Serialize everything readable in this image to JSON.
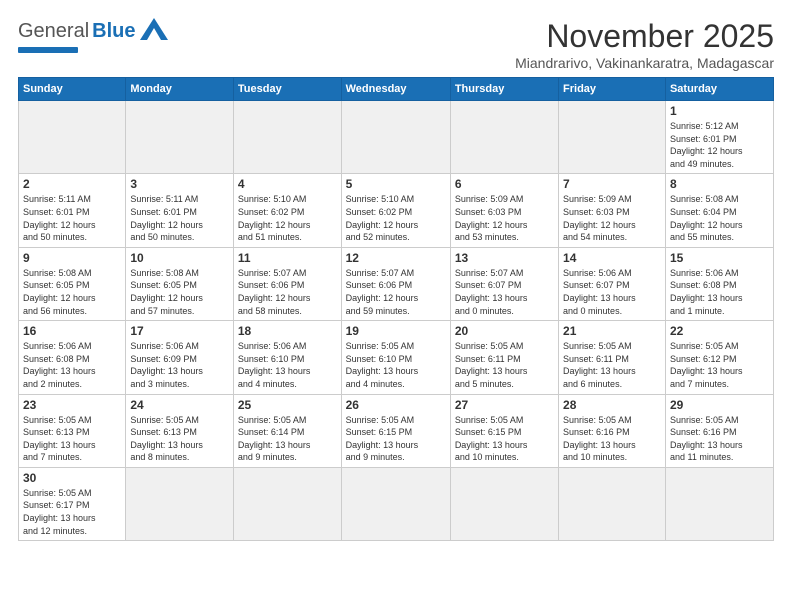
{
  "logo": {
    "line1": "General",
    "line2": "Blue"
  },
  "title": "November 2025",
  "location": "Miandrarivo, Vakinankaratra, Madagascar",
  "days_of_week": [
    "Sunday",
    "Monday",
    "Tuesday",
    "Wednesday",
    "Thursday",
    "Friday",
    "Saturday"
  ],
  "weeks": [
    [
      {
        "day": "",
        "empty": true
      },
      {
        "day": "",
        "empty": true
      },
      {
        "day": "",
        "empty": true
      },
      {
        "day": "",
        "empty": true
      },
      {
        "day": "",
        "empty": true
      },
      {
        "day": "",
        "empty": true
      },
      {
        "day": "1",
        "info": "Sunrise: 5:12 AM\nSunset: 6:01 PM\nDaylight: 12 hours\nand 49 minutes."
      }
    ],
    [
      {
        "day": "2",
        "info": "Sunrise: 5:11 AM\nSunset: 6:01 PM\nDaylight: 12 hours\nand 50 minutes."
      },
      {
        "day": "3",
        "info": "Sunrise: 5:11 AM\nSunset: 6:01 PM\nDaylight: 12 hours\nand 50 minutes."
      },
      {
        "day": "4",
        "info": "Sunrise: 5:10 AM\nSunset: 6:02 PM\nDaylight: 12 hours\nand 51 minutes."
      },
      {
        "day": "5",
        "info": "Sunrise: 5:10 AM\nSunset: 6:02 PM\nDaylight: 12 hours\nand 52 minutes."
      },
      {
        "day": "6",
        "info": "Sunrise: 5:09 AM\nSunset: 6:03 PM\nDaylight: 12 hours\nand 53 minutes."
      },
      {
        "day": "7",
        "info": "Sunrise: 5:09 AM\nSunset: 6:03 PM\nDaylight: 12 hours\nand 54 minutes."
      },
      {
        "day": "8",
        "info": "Sunrise: 5:08 AM\nSunset: 6:04 PM\nDaylight: 12 hours\nand 55 minutes."
      }
    ],
    [
      {
        "day": "9",
        "info": "Sunrise: 5:08 AM\nSunset: 6:05 PM\nDaylight: 12 hours\nand 56 minutes."
      },
      {
        "day": "10",
        "info": "Sunrise: 5:08 AM\nSunset: 6:05 PM\nDaylight: 12 hours\nand 57 minutes."
      },
      {
        "day": "11",
        "info": "Sunrise: 5:07 AM\nSunset: 6:06 PM\nDaylight: 12 hours\nand 58 minutes."
      },
      {
        "day": "12",
        "info": "Sunrise: 5:07 AM\nSunset: 6:06 PM\nDaylight: 12 hours\nand 59 minutes."
      },
      {
        "day": "13",
        "info": "Sunrise: 5:07 AM\nSunset: 6:07 PM\nDaylight: 13 hours\nand 0 minutes."
      },
      {
        "day": "14",
        "info": "Sunrise: 5:06 AM\nSunset: 6:07 PM\nDaylight: 13 hours\nand 0 minutes."
      },
      {
        "day": "15",
        "info": "Sunrise: 5:06 AM\nSunset: 6:08 PM\nDaylight: 13 hours\nand 1 minute."
      }
    ],
    [
      {
        "day": "16",
        "info": "Sunrise: 5:06 AM\nSunset: 6:08 PM\nDaylight: 13 hours\nand 2 minutes."
      },
      {
        "day": "17",
        "info": "Sunrise: 5:06 AM\nSunset: 6:09 PM\nDaylight: 13 hours\nand 3 minutes."
      },
      {
        "day": "18",
        "info": "Sunrise: 5:06 AM\nSunset: 6:10 PM\nDaylight: 13 hours\nand 4 minutes."
      },
      {
        "day": "19",
        "info": "Sunrise: 5:05 AM\nSunset: 6:10 PM\nDaylight: 13 hours\nand 4 minutes."
      },
      {
        "day": "20",
        "info": "Sunrise: 5:05 AM\nSunset: 6:11 PM\nDaylight: 13 hours\nand 5 minutes."
      },
      {
        "day": "21",
        "info": "Sunrise: 5:05 AM\nSunset: 6:11 PM\nDaylight: 13 hours\nand 6 minutes."
      },
      {
        "day": "22",
        "info": "Sunrise: 5:05 AM\nSunset: 6:12 PM\nDaylight: 13 hours\nand 7 minutes."
      }
    ],
    [
      {
        "day": "23",
        "info": "Sunrise: 5:05 AM\nSunset: 6:13 PM\nDaylight: 13 hours\nand 7 minutes."
      },
      {
        "day": "24",
        "info": "Sunrise: 5:05 AM\nSunset: 6:13 PM\nDaylight: 13 hours\nand 8 minutes."
      },
      {
        "day": "25",
        "info": "Sunrise: 5:05 AM\nSunset: 6:14 PM\nDaylight: 13 hours\nand 9 minutes."
      },
      {
        "day": "26",
        "info": "Sunrise: 5:05 AM\nSunset: 6:15 PM\nDaylight: 13 hours\nand 9 minutes."
      },
      {
        "day": "27",
        "info": "Sunrise: 5:05 AM\nSunset: 6:15 PM\nDaylight: 13 hours\nand 10 minutes."
      },
      {
        "day": "28",
        "info": "Sunrise: 5:05 AM\nSunset: 6:16 PM\nDaylight: 13 hours\nand 10 minutes."
      },
      {
        "day": "29",
        "info": "Sunrise: 5:05 AM\nSunset: 6:16 PM\nDaylight: 13 hours\nand 11 minutes."
      }
    ],
    [
      {
        "day": "30",
        "info": "Sunrise: 5:05 AM\nSunset: 6:17 PM\nDaylight: 13 hours\nand 12 minutes."
      },
      {
        "day": "",
        "empty": true
      },
      {
        "day": "",
        "empty": true
      },
      {
        "day": "",
        "empty": true
      },
      {
        "day": "",
        "empty": true
      },
      {
        "day": "",
        "empty": true
      },
      {
        "day": "",
        "empty": true
      }
    ]
  ]
}
